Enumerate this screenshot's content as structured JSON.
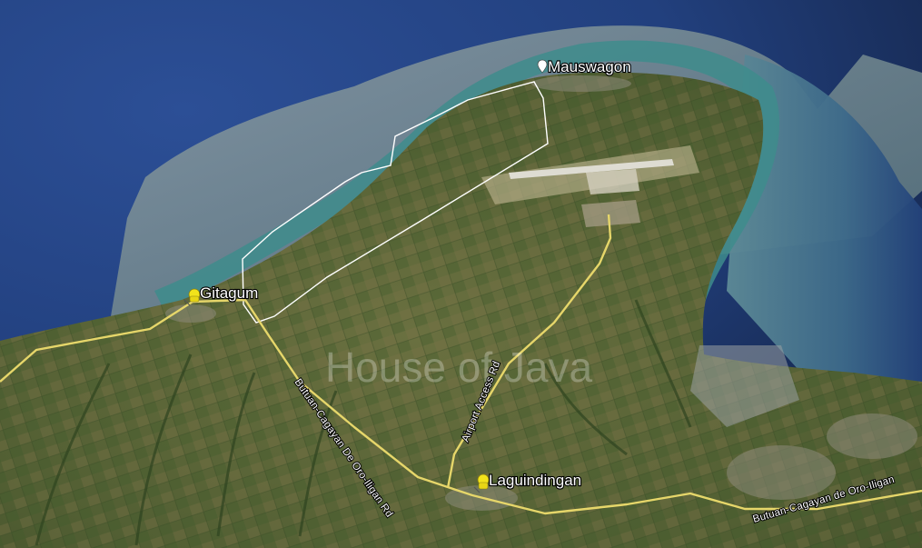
{
  "places": {
    "mauswagon": "Mauswagon",
    "gitagum": "Gitagum",
    "laguindingan": "Laguindingan"
  },
  "roads": {
    "butuan_west": "Butuan-Cagayan De Oro-Iligan Rd",
    "airport_access": "Airport Access Rd",
    "butuan_east": "Butuan-Cagayan de Oro-Iligan"
  },
  "watermark": "House of Java",
  "icons": {
    "pin_white": "white-placemark-icon",
    "pin_yellow": "yellow-pushpin-icon"
  },
  "colors": {
    "sea_deep": "#1b2f62",
    "sea_shallow": "#5f8f95",
    "reef": "#3c8a8a",
    "land": "#5a6638",
    "road": "#e6d66a",
    "boundary": "#ffffff",
    "pin_yellow": "#f2e31b"
  }
}
